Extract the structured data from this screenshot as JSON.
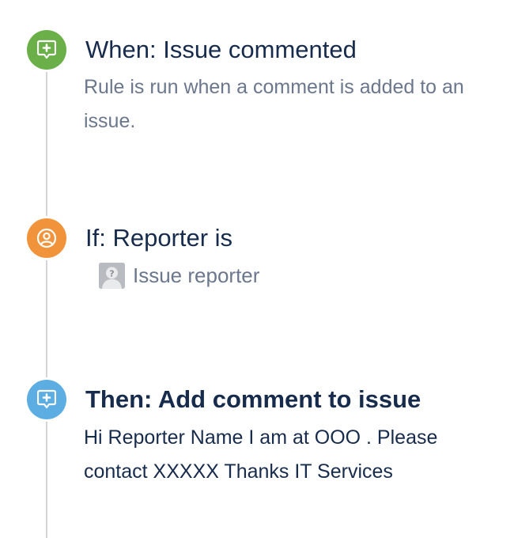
{
  "rule": {
    "trigger": {
      "title": "When: Issue commented",
      "description": "Rule is run when a comment is added to an issue.",
      "icon": "comment-add-icon",
      "color": "#6aaf47"
    },
    "condition": {
      "title": "If: Reporter is",
      "user_label": "Issue reporter",
      "icon": "user-icon",
      "color": "#f1933a"
    },
    "action": {
      "title": "Then: Add comment to issue",
      "comment_text": "Hi Reporter Name I am at OOO . Please contact XXXXX Thanks IT Services",
      "icon": "comment-add-icon",
      "color": "#5bade2"
    }
  }
}
